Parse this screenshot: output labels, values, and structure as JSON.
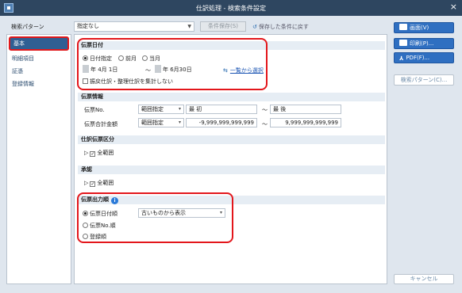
{
  "window": {
    "title": "仕訳処理 - 検索条件設定",
    "close_glyph": "×"
  },
  "top": {
    "pattern_label": "検索パターン",
    "pattern_value": "指定なし",
    "save_condition": "条件保存(S)",
    "restore_link": "保存した条件に戻す"
  },
  "nav": {
    "items": [
      "基本",
      "明細項目",
      "証憑",
      "登録情報"
    ]
  },
  "date_group": {
    "title": "伝票日付",
    "radio_date": "日付指定",
    "radio_prev_month": "前月",
    "radio_this_month": "当月",
    "from_date": "年  4月  1日",
    "tilde": "～",
    "to_date": "年  6月30日",
    "list_select_link": "一覧から選択",
    "exclude_checkbox": "振戻仕訳・整理仕訳を集計しない"
  },
  "voucher_info": {
    "title": "伝票情報",
    "no_label": "伝票No.",
    "no_mode": "範囲指定",
    "no_from": "最 初",
    "no_to": "最 後",
    "total_label": "伝票合計金額",
    "total_mode": "範囲指定",
    "total_from": "-9,999,999,999,999",
    "total_to": "9,999,999,999,999",
    "tilde": "～"
  },
  "journal_category": {
    "title": "仕訳伝票区分",
    "all": "全範囲"
  },
  "approval": {
    "title": "承認",
    "all": "全範囲"
  },
  "output_order": {
    "title": "伝票出力順",
    "info_glyph": "i",
    "option_date": "伝票日付順",
    "sort_value": "古いものから表示",
    "option_no": "伝票No.順",
    "option_reg": "登録順"
  },
  "actions": {
    "screen": "画面(V)",
    "print": "印刷(P)...",
    "pdf": "PDF(F)...",
    "search_pattern": "検索パターン(C)...",
    "cancel": "キャンセル"
  }
}
